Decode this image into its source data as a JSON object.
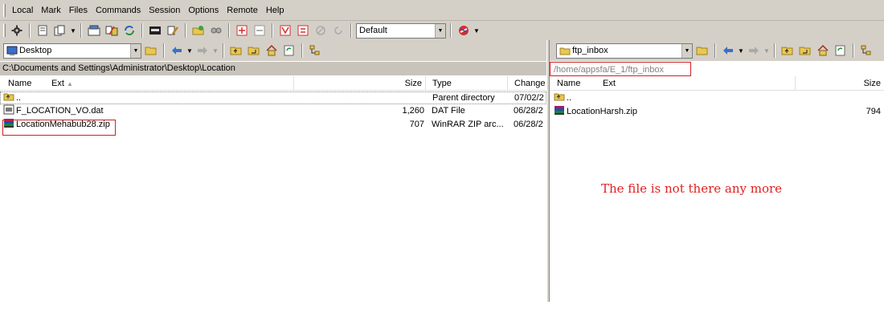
{
  "menu": {
    "items": [
      "Local",
      "Mark",
      "Files",
      "Commands",
      "Session",
      "Options",
      "Remote",
      "Help"
    ]
  },
  "toolbar": {
    "transfer_profile": "Default"
  },
  "left_panel": {
    "location_combo": "Desktop",
    "path": "C:\\Documents and Settings\\Administrator\\Desktop\\Location",
    "columns": [
      "Name",
      "Ext",
      "Size",
      "Type",
      "Change"
    ],
    "rows": [
      {
        "name": "..",
        "size": "",
        "type": "Parent directory",
        "changed": "07/02/2"
      },
      {
        "name": "F_LOCATION_VO.dat",
        "size": "1,260",
        "type": "DAT File",
        "changed": "06/28/2"
      },
      {
        "name": "LocationMehabub28.zip",
        "size": "707",
        "type": "WinRAR ZIP arc...",
        "changed": "06/28/2"
      }
    ]
  },
  "right_panel": {
    "location_combo": "ftp_inbox",
    "path": "/home/appsfa/E_1/ftp_inbox",
    "columns": [
      "Name",
      "Ext",
      "Size"
    ],
    "rows": [
      {
        "name": "..",
        "size": ""
      },
      {
        "name": "LocationHarsh.zip",
        "size": "794"
      }
    ]
  },
  "annotation": {
    "note": "The file is not there any more"
  },
  "colors": {
    "chrome": "#d4d0c8",
    "annotation_red": "#e02020"
  }
}
